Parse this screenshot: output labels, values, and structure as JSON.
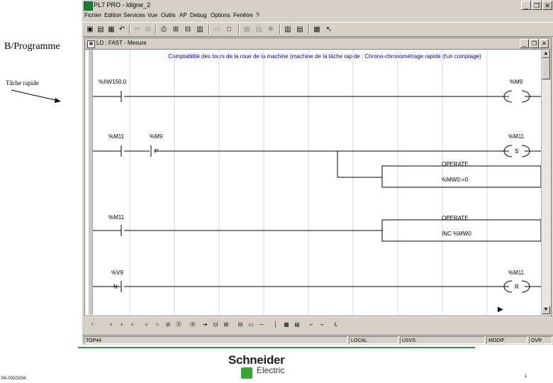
{
  "slide": {
    "title": "B/Programme",
    "note": "Tâche rapide",
    "footer_code": "PA.002/2004",
    "page_num": "1"
  },
  "app": {
    "title": "PL7 PRO - ldigne_2",
    "menu": [
      "Fichier",
      "Edition",
      "Services",
      "Vue",
      "Outils",
      "AP",
      "Debug",
      "Options",
      "Fenêtre",
      "?"
    ],
    "window_buttons": {
      "minimize": "_",
      "restore": "❐",
      "close": "✕"
    }
  },
  "editor": {
    "title": "LD : FAST - Mesure",
    "comment": "Comptabilité des tours de la roue de la machine (machine de la tâche rapide : Chrono-chronométrage rapide d'un comptage)",
    "rungs": [
      {
        "contact": "%I\\W150.0",
        "coil": "%M9"
      },
      {
        "contact1": "%M11",
        "contact2": "%M9",
        "contact2_mark": "P",
        "coil": "%M11",
        "coil_type": "S",
        "block_title": "OPERATE",
        "block_text": "%MW0:=0"
      },
      {
        "contact": "%M11",
        "block_title": "OPERATE",
        "block_text": "INC %MW0"
      },
      {
        "contact": "%V9",
        "contact_mark": "N",
        "coil": "%M11",
        "coil_type": "R"
      }
    ]
  },
  "status": [
    "TOP44",
    "LOCAL",
    "USVS",
    "MODIF",
    "OVR"
  ],
  "brand": {
    "name": "Schneider",
    "sub": "Electric",
    "mark_color": "#3aa535",
    "line_color": "#3a8a4a"
  }
}
